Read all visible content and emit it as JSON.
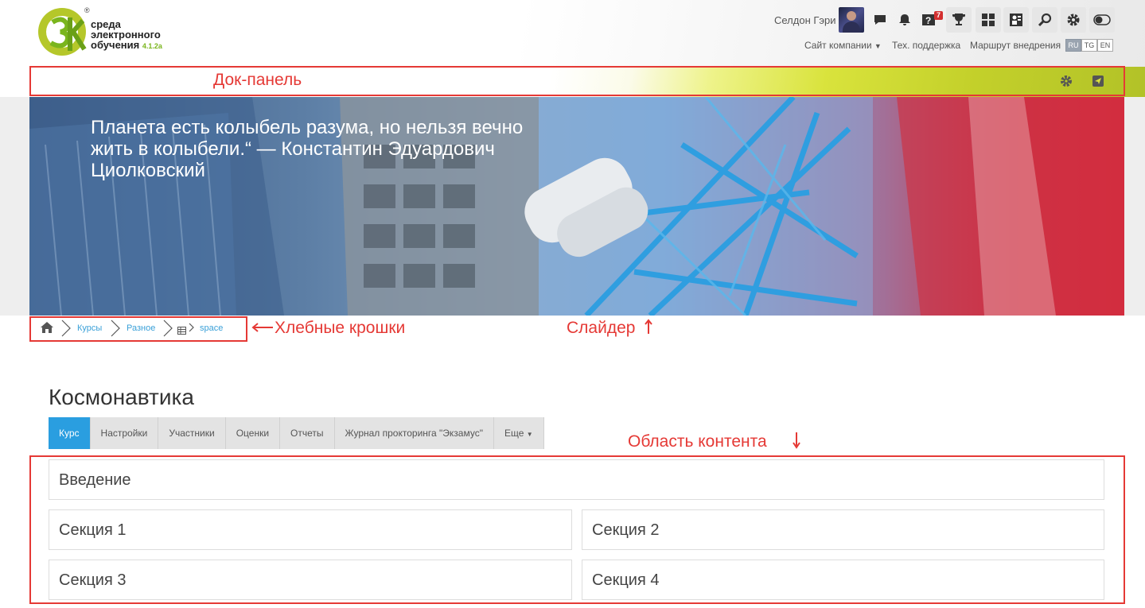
{
  "logo": {
    "name_line1": "среда",
    "name_line2": "электронного",
    "name_line3": "обучения",
    "version": "4.1.2a",
    "reg_mark": "®"
  },
  "header": {
    "user_name": "Селдон Гэри",
    "badge_count": "7",
    "nav": {
      "company_site": "Сайт компании",
      "support": "Тех. поддержка",
      "route": "Маршрут внедрения"
    },
    "langs": [
      "RU",
      "TG",
      "EN"
    ],
    "icons": [
      "chat-icon",
      "bell-icon",
      "question-icon",
      "trophy-icon",
      "dashboard-icon",
      "portfolio-icon",
      "search-icon",
      "gear-icon",
      "toggle-icon"
    ]
  },
  "annotations": {
    "dock": "Док-панель",
    "breadcrumbs": "Хлебные крошки",
    "slider": "Слайдер",
    "content": "Область контента"
  },
  "slider": {
    "quote": "Планета есть колыбель разума, но нельзя вечно жить в колыбели.“ — Константин Эдуардович Циолковский"
  },
  "breadcrumbs": {
    "items": [
      "Курсы",
      "Разное",
      "space"
    ]
  },
  "course": {
    "title": "Космонавтика",
    "tabs": [
      "Курс",
      "Настройки",
      "Участники",
      "Оценки",
      "Отчеты",
      "Журнал прокторинга \"Экзамус\"",
      "Еще"
    ],
    "sections": [
      "Введение",
      "Секция 1",
      "Секция 2",
      "Секция 3",
      "Секция 4"
    ]
  },
  "colors": {
    "accent": "#2a9ee0",
    "annotation": "#e53935",
    "link": "#3aa0d8"
  }
}
